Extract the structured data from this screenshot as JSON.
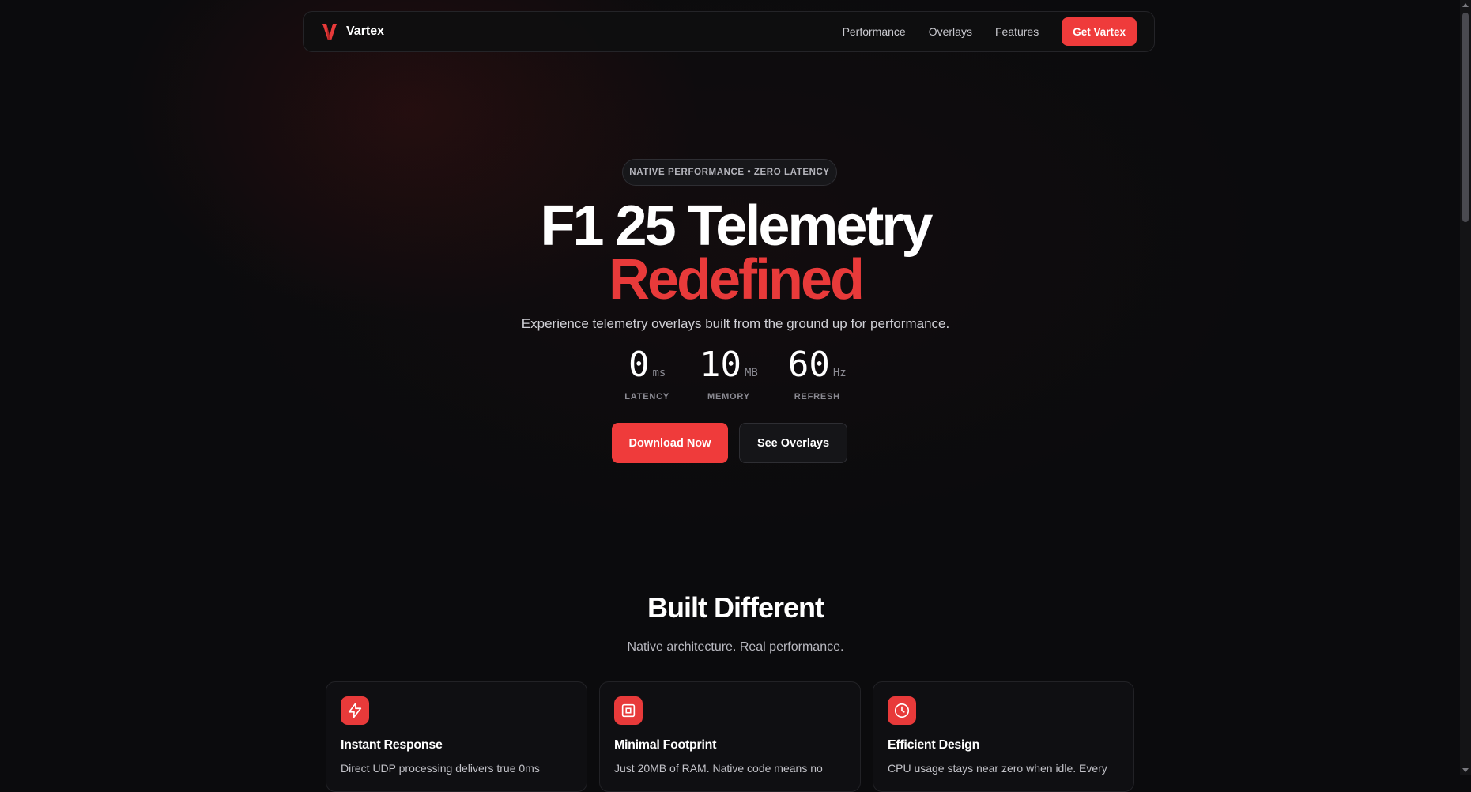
{
  "brand": {
    "name": "Vartex",
    "logo_icon": "v-logo-icon",
    "accent": "#ef3b3b"
  },
  "nav": {
    "links": [
      "Performance",
      "Overlays",
      "Features"
    ],
    "cta": "Get Vartex"
  },
  "hero": {
    "badge": "NATIVE PERFORMANCE • ZERO LATENCY",
    "title_line1": "F1 25 Telemetry",
    "title_line2": "Redefined",
    "subtitle": "Experience telemetry overlays built from the ground up for performance.",
    "stats": [
      {
        "value": "0",
        "unit": "ms",
        "label": "LATENCY"
      },
      {
        "value": "10",
        "unit": "MB",
        "label": "MEMORY"
      },
      {
        "value": "60",
        "unit": "Hz",
        "label": "REFRESH"
      }
    ],
    "primary_button": "Download Now",
    "secondary_button": "See Overlays"
  },
  "section": {
    "title": "Built Different",
    "subtitle": "Native architecture. Real performance.",
    "cards": [
      {
        "icon": "lightning-icon",
        "title": "Instant Response",
        "text": "Direct UDP processing delivers true 0ms"
      },
      {
        "icon": "chip-icon",
        "title": "Minimal Footprint",
        "text": "Just 20MB of RAM. Native code means no"
      },
      {
        "icon": "clock-icon",
        "title": "Efficient Design",
        "text": "CPU usage stays near zero when idle. Every"
      }
    ]
  }
}
